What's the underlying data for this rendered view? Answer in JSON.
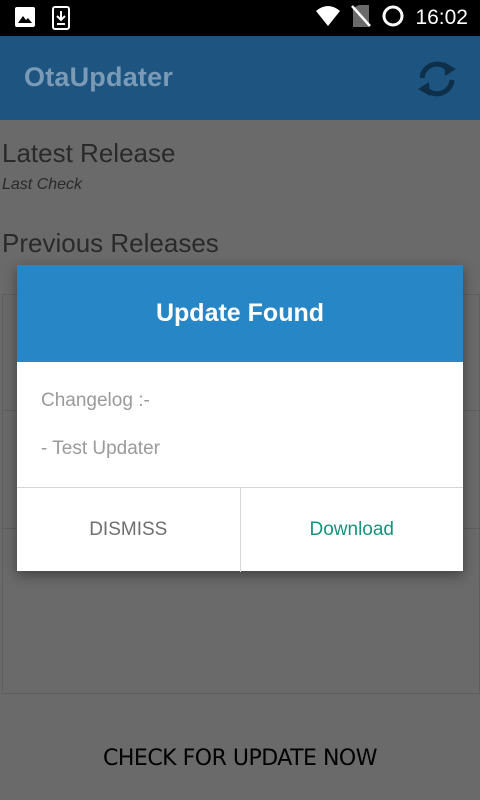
{
  "status_bar": {
    "time": "16:02",
    "icons": [
      "image-notification-icon",
      "download-notification-icon",
      "wifi-icon",
      "no-sim-icon",
      "battery-charging-icon"
    ]
  },
  "app_bar": {
    "title": "OtaUpdater",
    "refresh_icon": "refresh-icon"
  },
  "content": {
    "latest_release_title": "Latest Release",
    "last_check_label": "Last Check",
    "previous_releases_title": "Previous Releases",
    "check_now_label": "CHECK FOR UPDATE NOW"
  },
  "dialog": {
    "title": "Update Found",
    "changelog_label": "Changelog :-",
    "changelog_items": [
      "- Test Updater"
    ],
    "dismiss_label": "DISMISS",
    "download_label": "Download"
  },
  "colors": {
    "app_bar": "#1d5580",
    "dialog_header": "#2686c6",
    "download_accent": "#16937f",
    "scrim_background": "#6a6a6a"
  }
}
